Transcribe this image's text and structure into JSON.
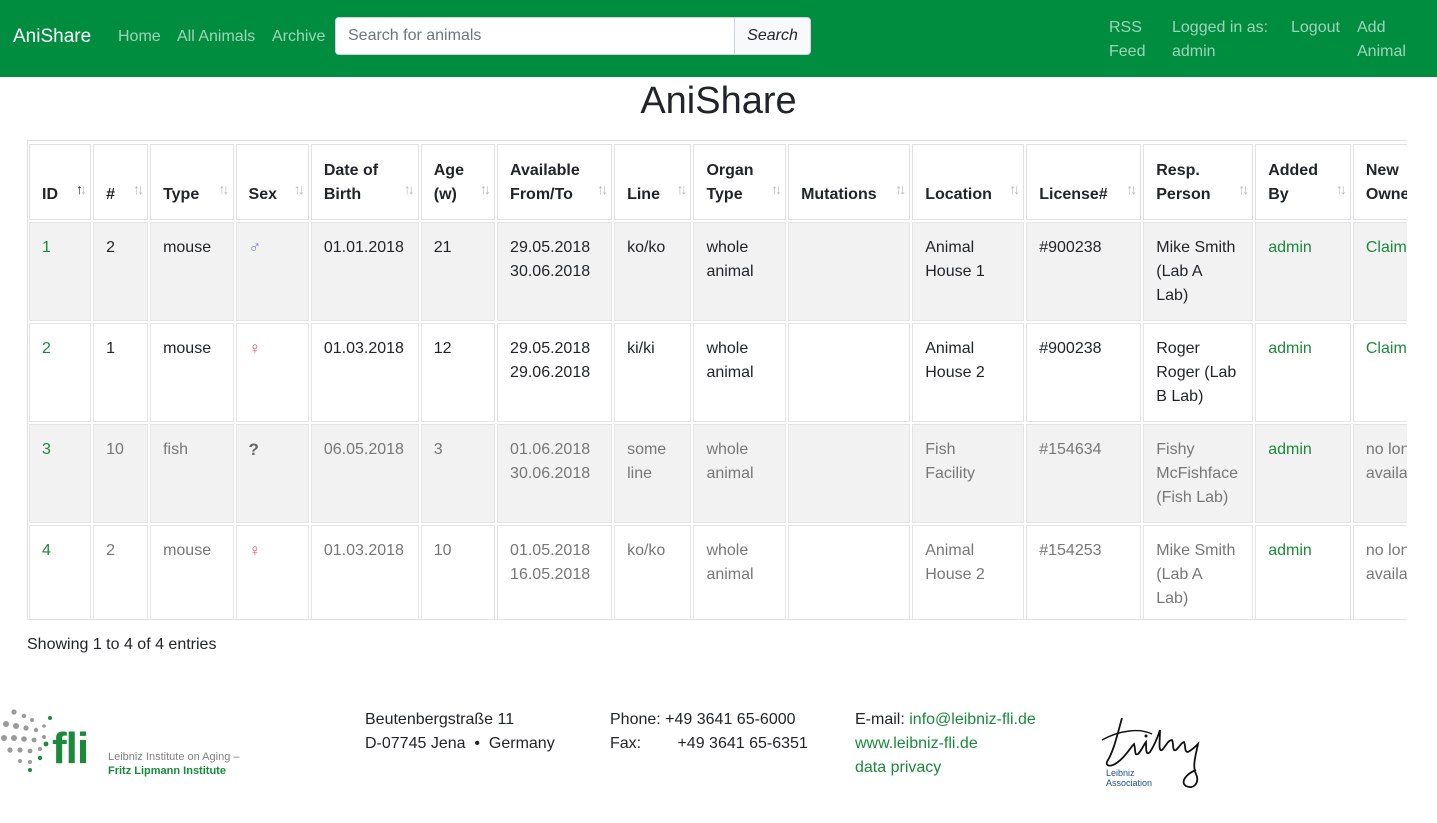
{
  "nav": {
    "brand": "AniShare",
    "links": [
      "Home",
      "All Animals",
      "Archive"
    ],
    "search_placeholder": "Search for animals",
    "search_button": "Search",
    "rss_line1": "RSS",
    "rss_line2": "Feed",
    "logged_in_line1": "Logged in as:",
    "logged_in_line2": "admin",
    "logout": "Logout",
    "add_line1": "Add",
    "add_line2": "Animal"
  },
  "page_title": "AniShare",
  "table": {
    "headers": [
      {
        "l1": "ID",
        "l2": ""
      },
      {
        "l1": "#",
        "l2": ""
      },
      {
        "l1": "Type",
        "l2": ""
      },
      {
        "l1": "Sex",
        "l2": ""
      },
      {
        "l1": "Date of",
        "l2": "Birth"
      },
      {
        "l1": "Age",
        "l2": "(w)"
      },
      {
        "l1": "Available",
        "l2": "From/To"
      },
      {
        "l1": "Line",
        "l2": ""
      },
      {
        "l1": "Organ",
        "l2": "Type"
      },
      {
        "l1": "Mutations",
        "l2": ""
      },
      {
        "l1": "Location",
        "l2": ""
      },
      {
        "l1": "License#",
        "l2": ""
      },
      {
        "l1": "Resp.",
        "l2": "Person"
      },
      {
        "l1": "Added",
        "l2": "By"
      },
      {
        "l1": "New",
        "l2": "Owner"
      }
    ],
    "rows": [
      {
        "id": "1",
        "count": "2",
        "type": "mouse",
        "sex": "♂",
        "dob": "01.01.2018",
        "age": "21",
        "from": "29.05.2018",
        "to": "30.06.2018",
        "line": "ko/ko",
        "organ1": "whole",
        "organ2": "animal",
        "mutations": "",
        "loc1": "Animal",
        "loc2": "House 1",
        "license": "#900238",
        "resp1": "Mike Smith",
        "resp2": "(Lab A",
        "resp3": "Lab)",
        "added_by": "admin",
        "owner1": "Claim!",
        "owner2": ""
      },
      {
        "id": "2",
        "count": "1",
        "type": "mouse",
        "sex": "♀",
        "dob": "01.03.2018",
        "age": "12",
        "from": "29.05.2018",
        "to": "29.06.2018",
        "line": "ki/ki",
        "organ1": "whole",
        "organ2": "animal",
        "mutations": "",
        "loc1": "Animal",
        "loc2": "House 2",
        "license": "#900238",
        "resp1": "Roger",
        "resp2": "Roger (Lab",
        "resp3": "B Lab)",
        "added_by": "admin",
        "owner1": "Claim!",
        "owner2": ""
      },
      {
        "id": "3",
        "count": "10",
        "type": "fish",
        "sex": "?",
        "dob": "06.05.2018",
        "age": "3",
        "from": "01.06.2018",
        "to": "30.06.2018",
        "line": "some line",
        "organ1": "whole",
        "organ2": "animal",
        "mutations": "",
        "loc1": "Fish",
        "loc2": "Facility",
        "license": "#154634",
        "resp1": "Fishy",
        "resp2": "McFishface",
        "resp3": "(Fish Lab)",
        "added_by": "admin",
        "owner1": "no longer",
        "owner2": "available"
      },
      {
        "id": "4",
        "count": "2",
        "type": "mouse",
        "sex": "♀",
        "dob": "01.03.2018",
        "age": "10",
        "from": "01.05.2018",
        "to": "16.05.2018",
        "line": "ko/ko",
        "organ1": "whole",
        "organ2": "animal",
        "mutations": "",
        "loc1": "Animal",
        "loc2": "House 2",
        "license": "#154253",
        "resp1": "Mike Smith",
        "resp2": "(Lab A",
        "resp3": "Lab)",
        "added_by": "admin",
        "owner1": "no longer",
        "owner2": "available"
      }
    ],
    "info": "Showing 1 to 4 of 4 entries"
  },
  "footer": {
    "fli_logo_text": "fli",
    "fli_sub1": "Leibniz Institute on Aging –",
    "fli_sub2": "Fritz Lipmann Institute",
    "address1": "Beutenbergstraße 11",
    "address2": "D-07745 Jena  •  Germany",
    "phone_label": "Phone:",
    "phone": "+49 3641 65-6000",
    "fax_label": "Fax:",
    "fax": "+49 3641 65-6351",
    "email_label": "E-mail:",
    "email": "info@leibniz-fli.de",
    "website": "www.leibniz-fli.de",
    "privacy": "data privacy",
    "leibniz_sub1": "Leibniz",
    "leibniz_sub2": "Association"
  },
  "colors": {
    "navbar": "#008d40",
    "link_green": "#1a8a3a",
    "male": "#7b7bd8",
    "female": "#e05a6a"
  }
}
